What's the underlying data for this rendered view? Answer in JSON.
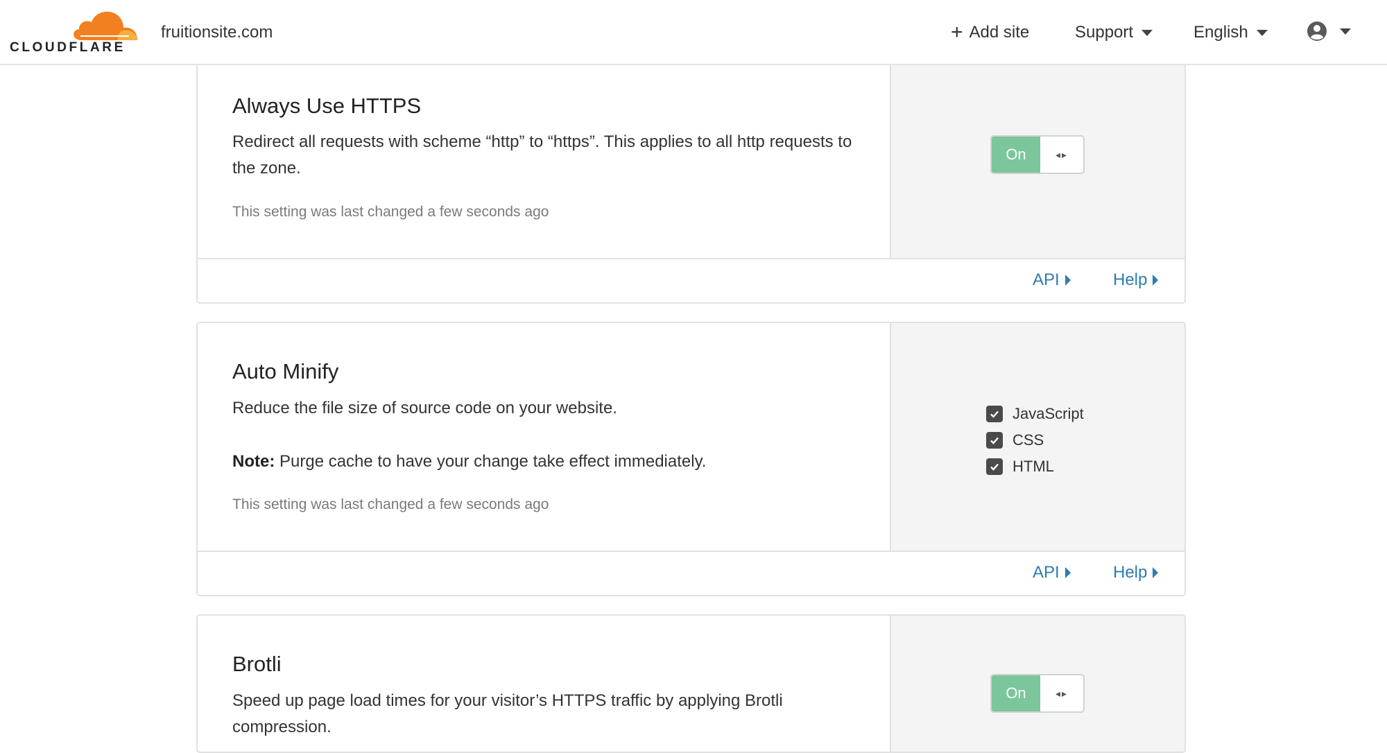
{
  "header": {
    "logo_text": "CLOUDFLARE",
    "site_name": "fruitionsite.com",
    "add_site": "Add site",
    "support": "Support",
    "language": "English"
  },
  "cards": [
    {
      "title": "Always Use HTTPS",
      "description": "Redirect all requests with scheme “http” to “https”. This applies to all http requests to the zone.",
      "last_changed": "This setting was last changed a few seconds ago",
      "toggle_label": "On",
      "api_link": "API",
      "help_link": "Help"
    },
    {
      "title": "Auto Minify",
      "description": "Reduce the file size of source code on your website.",
      "note_label": "Note:",
      "note_text": " Purge cache to have your change take effect immediately.",
      "last_changed": "This setting was last changed a few seconds ago",
      "options": [
        {
          "label": "JavaScript",
          "checked": true
        },
        {
          "label": "CSS",
          "checked": true
        },
        {
          "label": "HTML",
          "checked": true
        }
      ],
      "api_link": "API",
      "help_link": "Help"
    },
    {
      "title": "Brotli",
      "description": "Speed up page load times for your visitor’s HTTPS traffic by applying Brotli compression.",
      "toggle_label": "On"
    }
  ],
  "colors": {
    "brand_orange": "#f38020",
    "toggle_green": "#7bc69a",
    "link_blue": "#2c7cb0"
  }
}
